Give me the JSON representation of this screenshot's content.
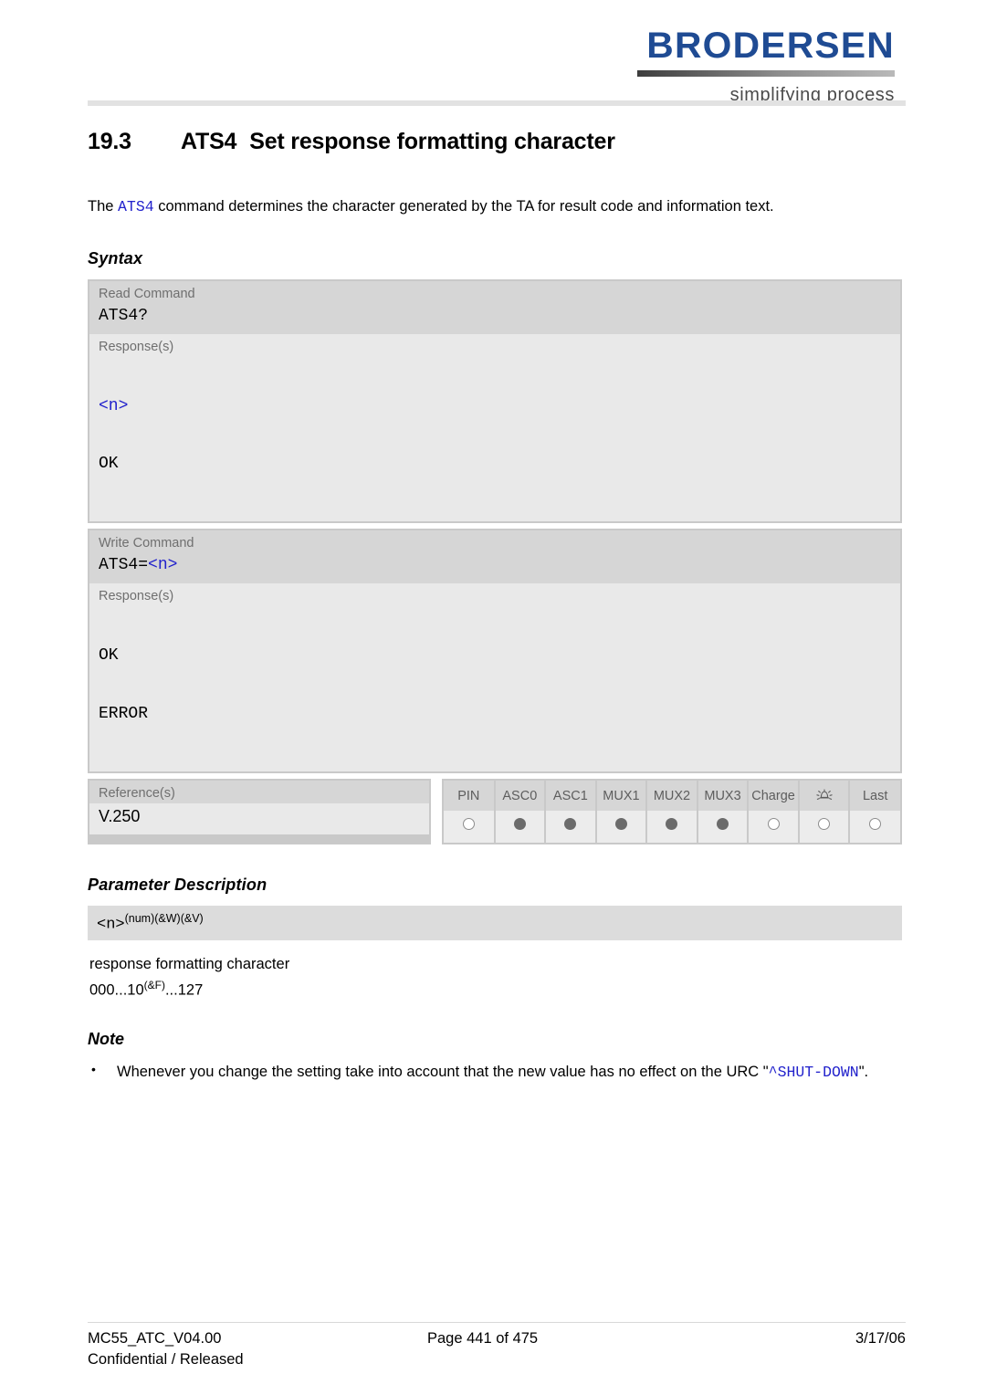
{
  "header": {
    "logo_word": "BRODERSEN",
    "logo_tagline": "simplifying process"
  },
  "title": {
    "number": "19.3",
    "command": "ATS4",
    "text": "Set response formatting character"
  },
  "intro": {
    "before": "The ",
    "command": "ATS4",
    "after": " command determines the character generated by the TA for result code and information text."
  },
  "syntax": {
    "heading": "Syntax",
    "read": {
      "label": "Read Command",
      "code": "ATS4?",
      "response_label": "Response(s)",
      "response_lines": [
        "<n>",
        "OK"
      ],
      "response_blue": [
        true,
        false
      ]
    },
    "write": {
      "label": "Write Command",
      "code_black": "ATS4=",
      "code_blue": "<n>",
      "response_label": "Response(s)",
      "response_lines": [
        "OK",
        "ERROR"
      ],
      "response_blue": [
        false,
        false
      ]
    },
    "reference": {
      "label": "Reference(s)",
      "value": "V.250"
    },
    "capabilities": {
      "columns": [
        "PIN",
        "ASC0",
        "ASC1",
        "MUX1",
        "MUX2",
        "MUX3",
        "Charge",
        "alarm-icon",
        "Last"
      ],
      "values": [
        false,
        true,
        true,
        true,
        true,
        true,
        false,
        false,
        false
      ]
    }
  },
  "parameter_description": {
    "heading": "Parameter Description",
    "param_name": "<n>",
    "param_sup": "(num)(&W)(&V)",
    "description": "response formatting character",
    "range_pre": "000...10",
    "range_sup": "(&F)",
    "range_post": "...127"
  },
  "note": {
    "heading": "Note",
    "items": [
      {
        "before": "Whenever you change the setting take into account that the new value has no effect on the URC \"",
        "code": "^SHUT-DOWN",
        "after": "\"."
      }
    ]
  },
  "footer": {
    "document": "MC55_ATC_V04.00",
    "classification": "Confidential / Released",
    "page": "Page 441 of 475",
    "date": "3/17/06"
  },
  "colors": {
    "brand_blue": "#1f4b93",
    "code_blue": "#2222cc",
    "band_dark": "#d6d6d6",
    "band_light": "#e9e9e9",
    "dot_filled": "#6b6b6b"
  }
}
